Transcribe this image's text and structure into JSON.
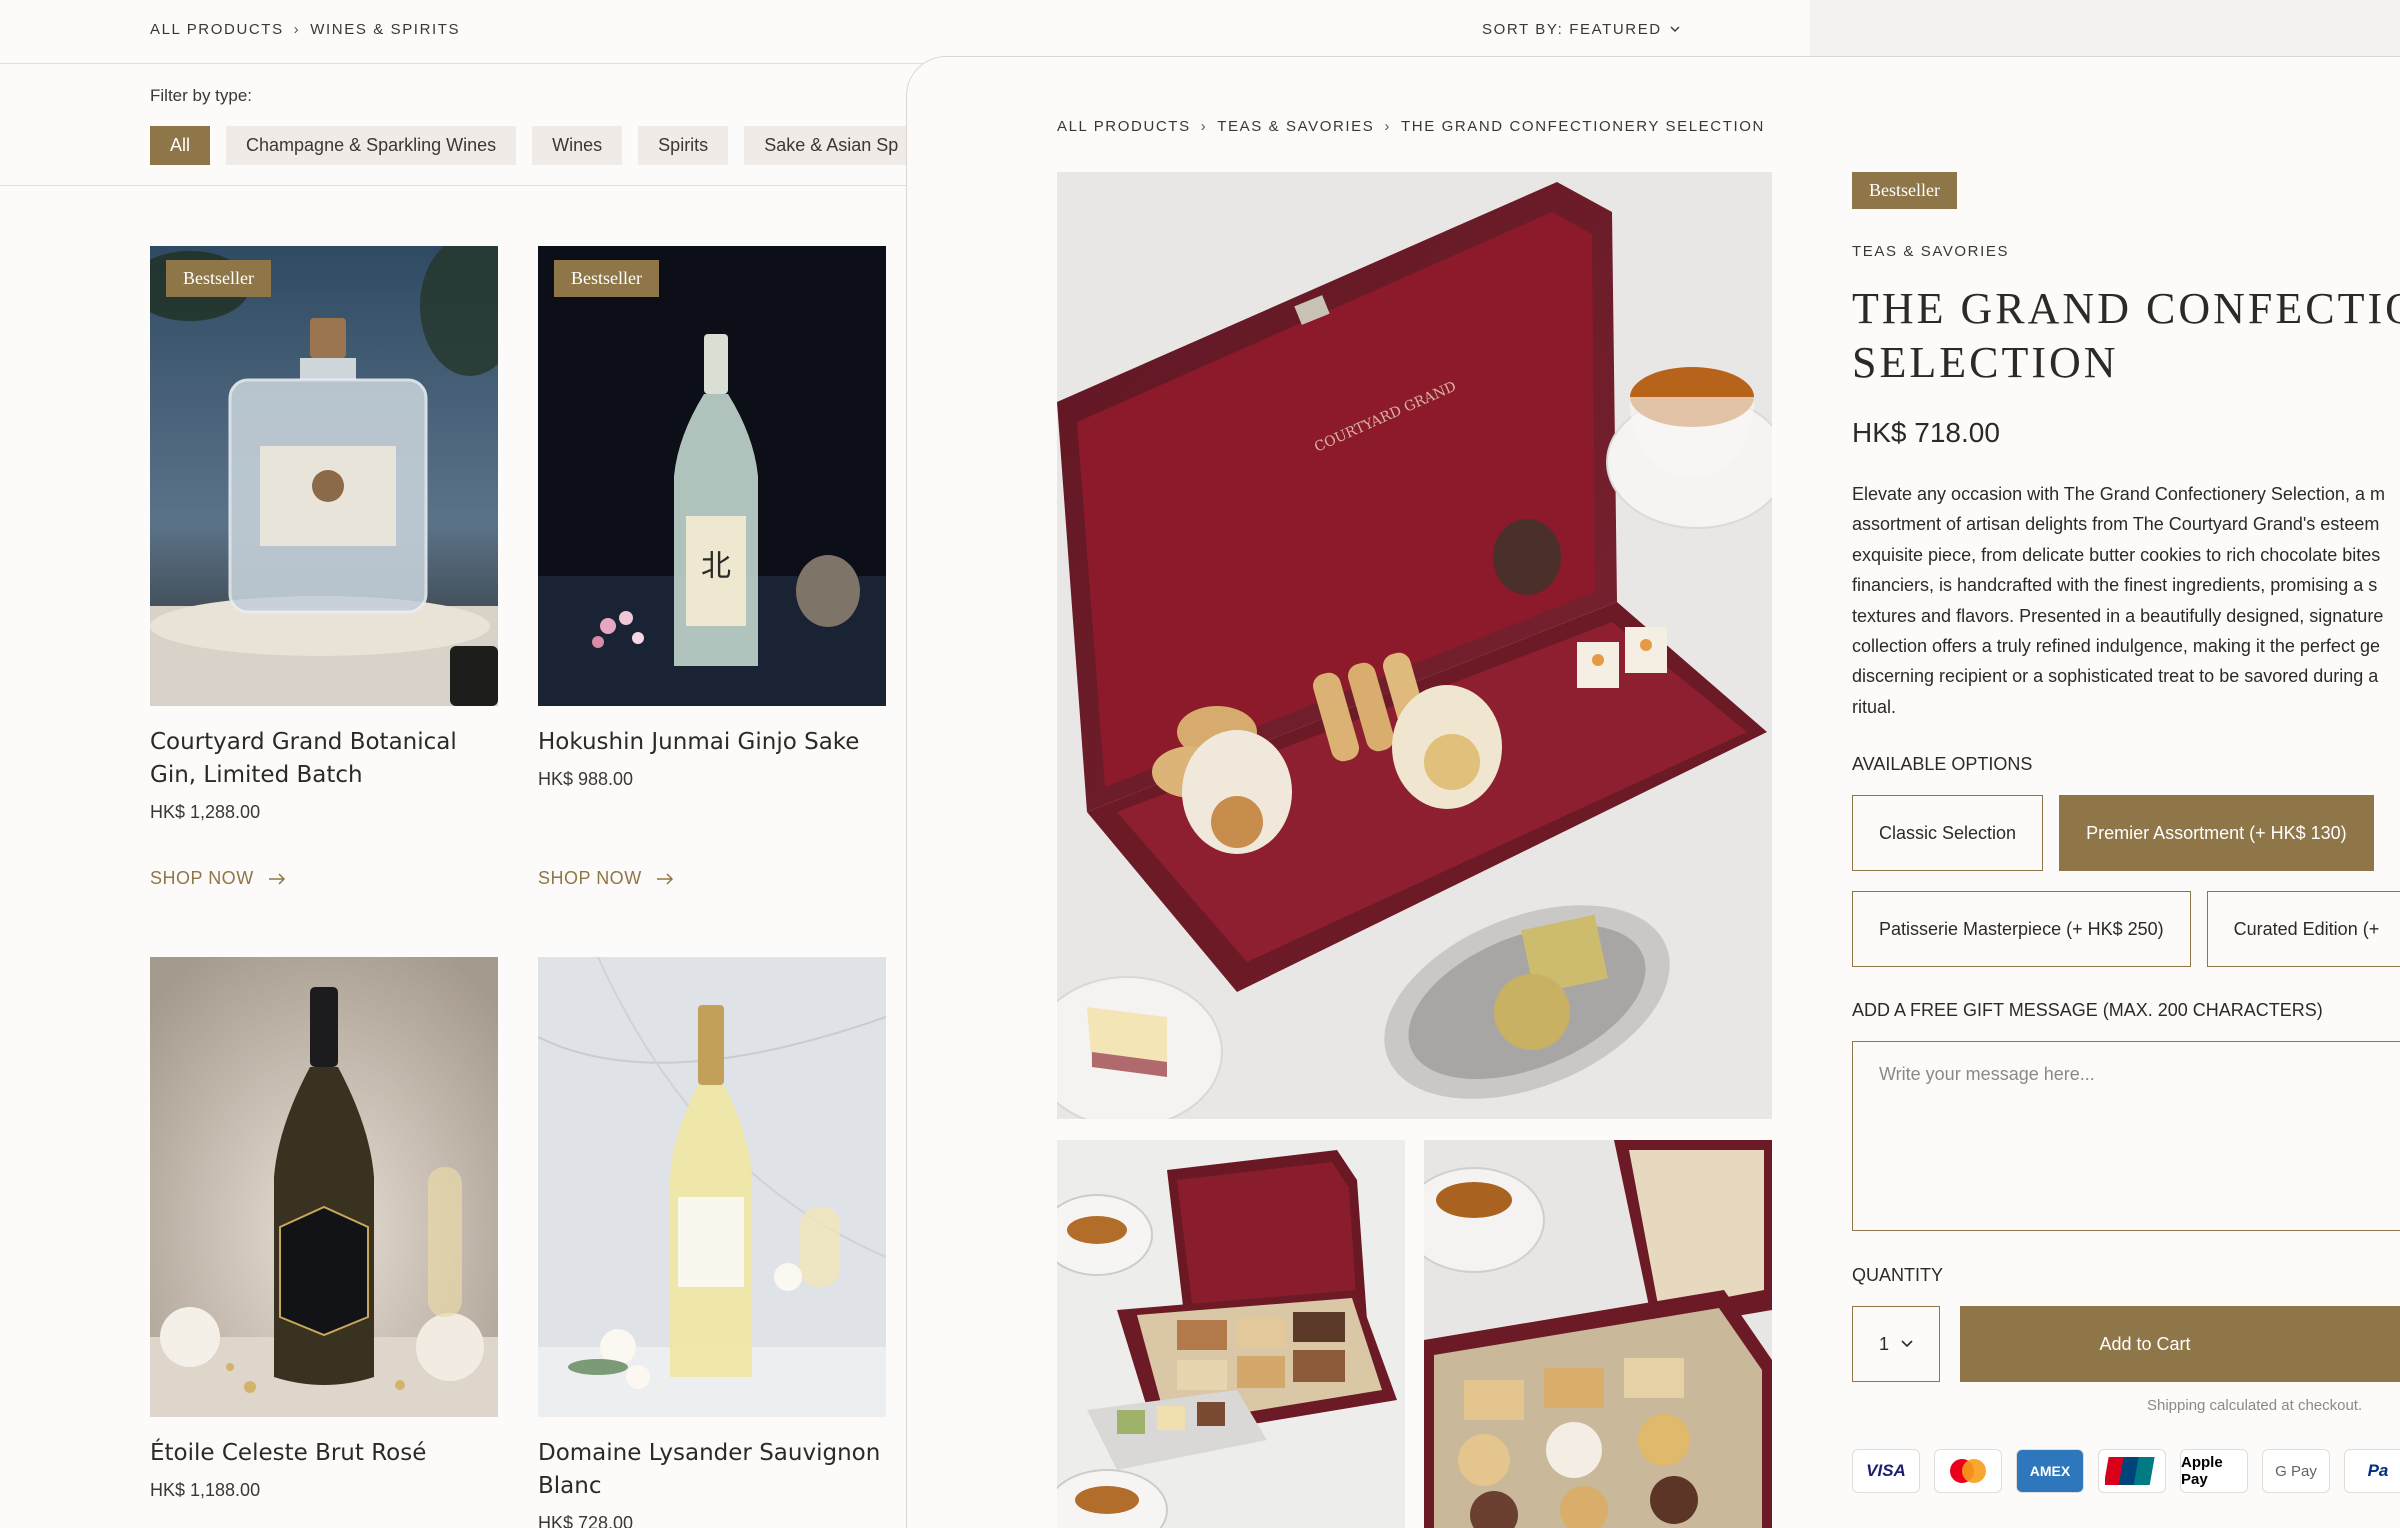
{
  "listing": {
    "breadcrumb": [
      "ALL PRODUCTS",
      "WINES & SPIRITS"
    ],
    "sort_label": "SORT BY: FEATURED",
    "filter_label": "Filter by type:",
    "filters": [
      "All",
      "Champagne & Sparkling Wines",
      "Wines",
      "Spirits",
      "Sake & Asian Sp"
    ],
    "products": [
      {
        "name": "Courtyard Grand Botanical Gin, Limited Batch",
        "price": "HK$ 1,288.00",
        "badge": "Bestseller",
        "cta": "SHOP NOW"
      },
      {
        "name": "Hokushin Junmai Ginjo Sake",
        "price": "HK$ 988.00",
        "badge": "Bestseller",
        "cta": "SHOP NOW"
      },
      {
        "name": "Étoile Celeste Brut Rosé",
        "price": "HK$ 1,188.00"
      },
      {
        "name": "Domaine Lysander Sauvignon Blanc",
        "price": "HK$ 728.00"
      }
    ]
  },
  "detail": {
    "breadcrumb": [
      "ALL PRODUCTS",
      "TEAS & SAVORIES",
      "THE GRAND CONFECTIONERY SELECTION"
    ],
    "badge": "Bestseller",
    "category": "TEAS & SAVORIES",
    "title_line1": "THE GRAND CONFECTIO",
    "title_line2": "SELECTION",
    "price": "HK$ 718.00",
    "description": "Elevate any occasion with The Grand Confectionery Selection, a m assortment of artisan delights from The Courtyard Grand's esteem exquisite piece, from delicate butter cookies to rich chocolate bites financiers, is handcrafted with the finest ingredients, promising a s textures and flavors. Presented in a beautifully designed, signature collection offers a truly refined indulgence, making it the perfect ge discerning recipient or a sophisticated treat to be savored during a ritual.",
    "options_label": "AVAILABLE OPTIONS",
    "options": [
      "Classic Selection",
      "Premier Assortment (+ HK$ 130)",
      "Patisserie Masterpiece (+ HK$ 250)",
      "Curated Edition (+"
    ],
    "selected_option": "Premier Assortment (+ HK$ 130)",
    "gift_label": "ADD A FREE GIFT MESSAGE (MAX. 200 CHARACTERS)",
    "gift_placeholder": "Write your message here...",
    "quantity_label": "QUANTITY",
    "quantity": "1",
    "add_to_cart": "Add to Cart",
    "shipping_note": "Shipping calculated at checkout.",
    "payments": [
      "VISA",
      "Mastercard",
      "AMEX",
      "UnionPay",
      "Apple Pay",
      "G Pay",
      "Pa"
    ]
  },
  "colors": {
    "accent": "#8f7648",
    "background": "#fdfbfa",
    "chip": "#f0ebe7"
  }
}
